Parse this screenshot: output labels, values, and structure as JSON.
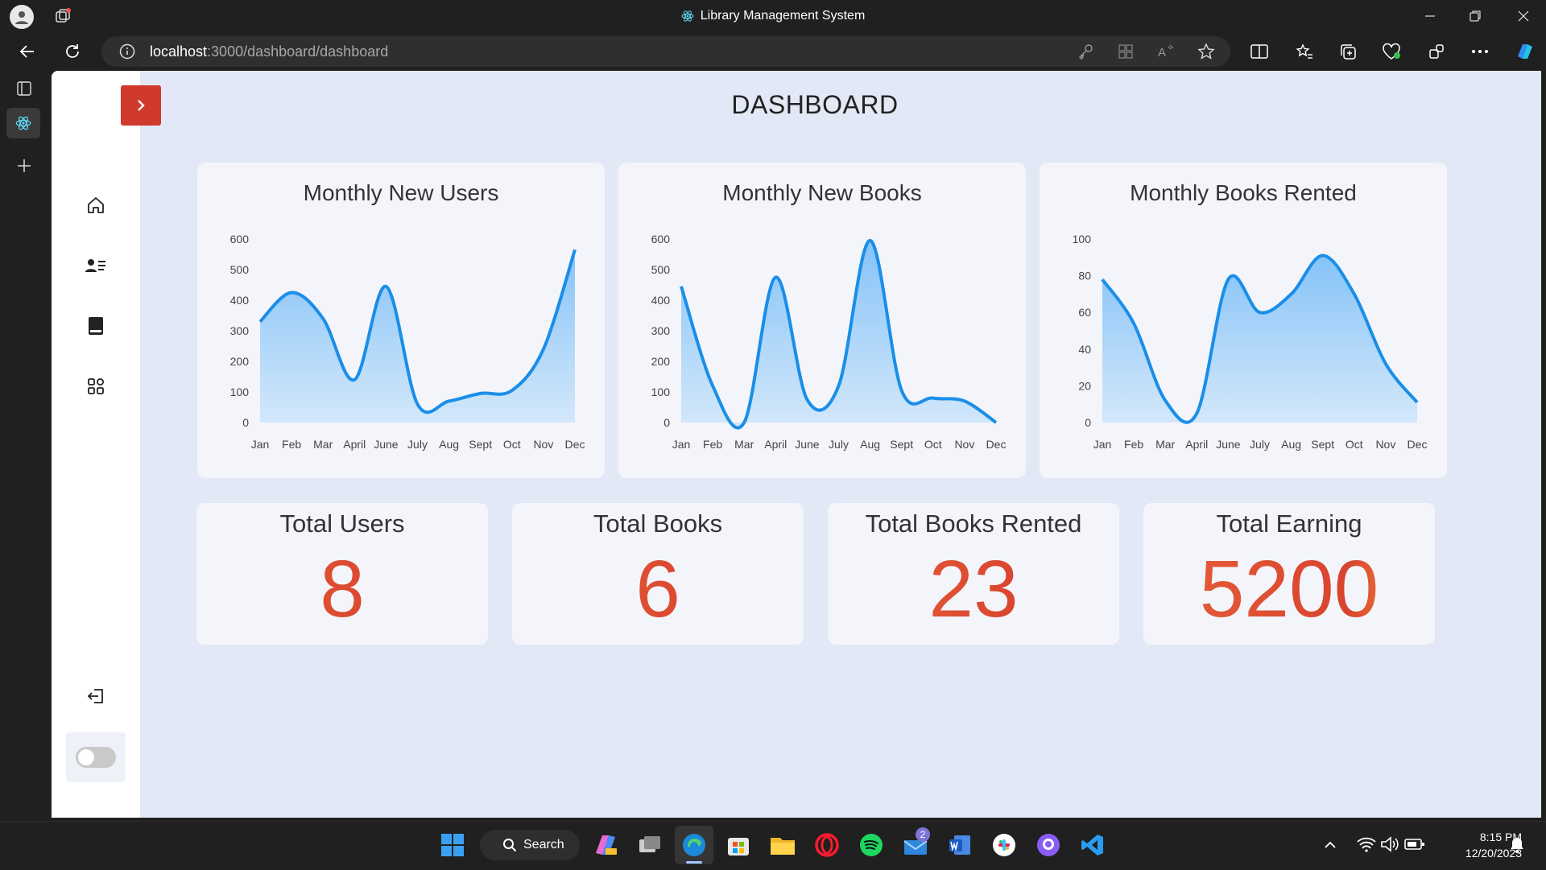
{
  "window": {
    "title": "Library Management System"
  },
  "browser": {
    "url_host": "localhost",
    "url_rest": ":3000/dashboard/dashboard"
  },
  "page": {
    "title": "DASHBOARD",
    "charts": [
      {
        "title": "Monthly New Users"
      },
      {
        "title": "Monthly New Books"
      },
      {
        "title": "Monthly Books Rented"
      }
    ],
    "stats": [
      {
        "title": "Total Users",
        "value": "8"
      },
      {
        "title": "Total Books",
        "value": "6"
      },
      {
        "title": "Total Books Rented",
        "value": "23"
      },
      {
        "title": "Total Earning",
        "value": "5200"
      }
    ]
  },
  "chart_data": [
    {
      "type": "area",
      "title": "Monthly New Users",
      "categories": [
        "Jan",
        "Feb",
        "Mar",
        "April",
        "June",
        "July",
        "Aug",
        "Sept",
        "Oct",
        "Nov",
        "Dec"
      ],
      "values": [
        330,
        425,
        340,
        140,
        445,
        60,
        70,
        95,
        105,
        240,
        565
      ],
      "ylim": [
        0,
        600
      ],
      "yticks": [
        0,
        100,
        200,
        300,
        400,
        500,
        600
      ],
      "color": "#1a8ee8",
      "grid": false
    },
    {
      "type": "area",
      "title": "Monthly New Books",
      "categories": [
        "Jan",
        "Feb",
        "Mar",
        "April",
        "June",
        "July",
        "Aug",
        "Sept",
        "Oct",
        "Nov",
        "Dec"
      ],
      "values": [
        445,
        120,
        0,
        475,
        75,
        120,
        595,
        105,
        80,
        70,
        0
      ],
      "ylim": [
        0,
        600
      ],
      "yticks": [
        0,
        100,
        200,
        300,
        400,
        500,
        600
      ],
      "color": "#1a8ee8",
      "grid": false
    },
    {
      "type": "area",
      "title": "Monthly Books Rented",
      "categories": [
        "Jan",
        "Feb",
        "Mar",
        "April",
        "June",
        "July",
        "Aug",
        "Sept",
        "Oct",
        "Nov",
        "Dec"
      ],
      "values": [
        78,
        54,
        12,
        5,
        78,
        60,
        70,
        91,
        70,
        32,
        11
      ],
      "ylim": [
        0,
        100
      ],
      "yticks": [
        0,
        20,
        40,
        60,
        80,
        100
      ],
      "color": "#1a8ee8",
      "grid": false
    }
  ],
  "taskbar": {
    "search_label": "Search",
    "time": "8:15 PM",
    "date": "12/20/2023",
    "mail_badge": "2"
  }
}
